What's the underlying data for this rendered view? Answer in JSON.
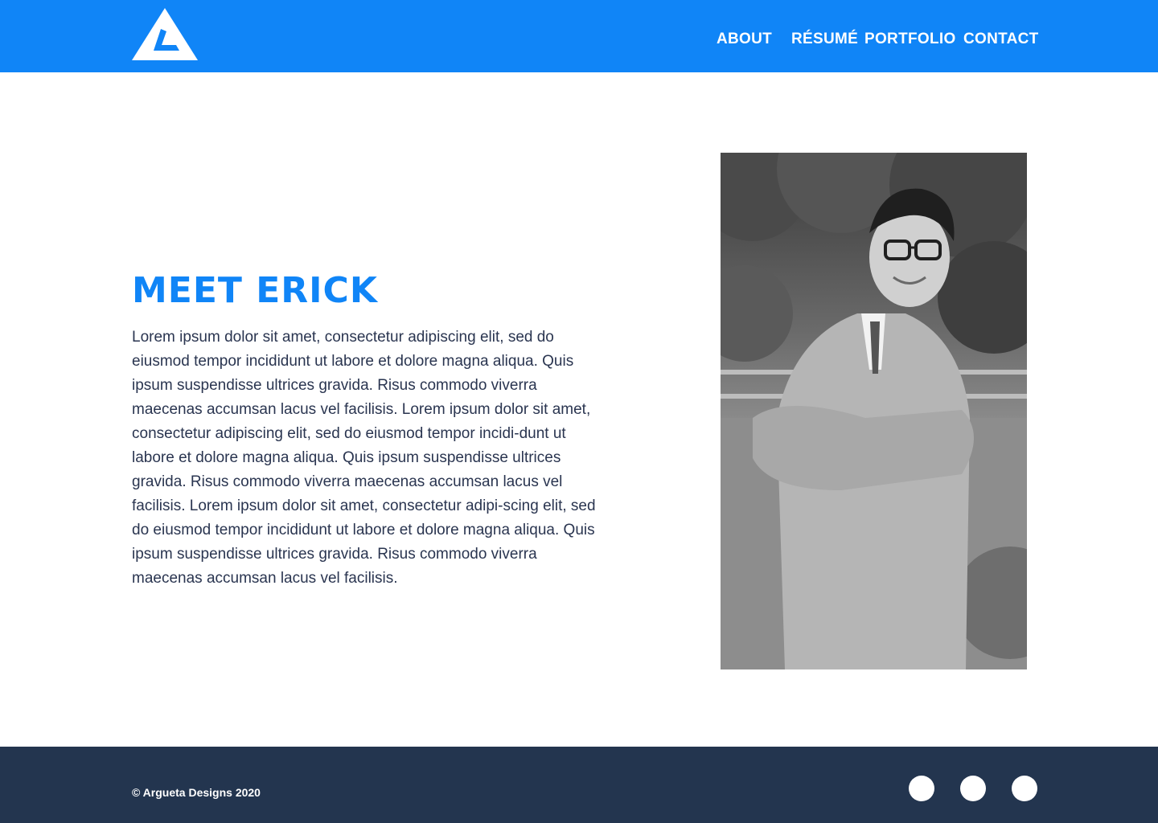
{
  "header": {
    "logo_icon": "triangle-monogram-logo-icon",
    "brand_color": "#1085f7",
    "nav": [
      {
        "label": "ABOUT"
      },
      {
        "label": "RÉSUMÉ"
      },
      {
        "label": "PORTFOLIO"
      },
      {
        "label": "CONTACT"
      }
    ]
  },
  "about": {
    "title": "MEET ERICK",
    "body": "Lorem ipsum dolor sit amet, consectetur adipiscing elit, sed do eiusmod tempor incididunt ut labore et dolore magna aliqua. Quis ipsum suspendisse ultrices gravida. Risus commodo viverra maecenas accumsan lacus vel facilisis. Lorem ipsum dolor sit amet, consectetur adipiscing elit, sed do eiusmod tempor incidi-dunt ut labore et dolore magna aliqua. Quis ipsum suspendisse ultrices gravida. Risus commodo viverra maecenas accumsan lacus vel facilisis. Lorem ipsum dolor sit amet, consectetur adipi-scing elit, sed do eiusmod tempor incididunt ut labore et dolore magna aliqua. Quis ipsum suspendisse ultrices gravida. Risus commodo viverra maecenas accumsan lacus vel facilisis."
  },
  "footer": {
    "copyright": "© Argueta Designs 2020",
    "background_color": "#23354f",
    "social_icons": [
      "social-icon",
      "social-icon",
      "social-icon"
    ]
  }
}
